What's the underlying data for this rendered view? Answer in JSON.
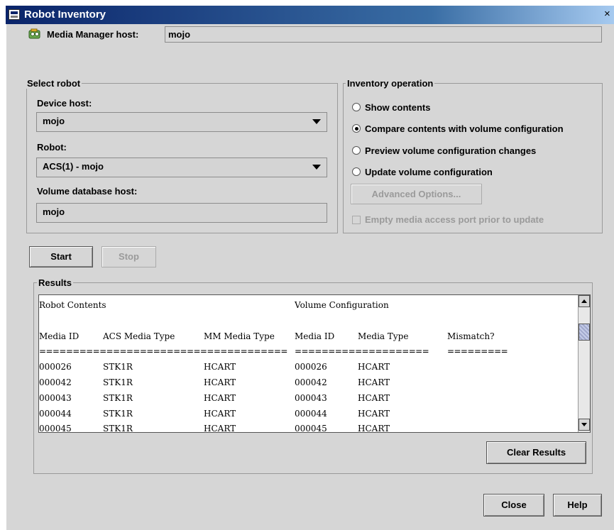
{
  "window": {
    "title": "Robot Inventory",
    "close_glyph": "×"
  },
  "media_manager": {
    "label": "Media Manager host:",
    "value": "mojo"
  },
  "select_robot": {
    "title": "Select robot",
    "device_host_label": "Device host:",
    "device_host_value": "mojo",
    "robot_label": "Robot:",
    "robot_value": "ACS(1) - mojo",
    "volume_db_label": "Volume database host:",
    "volume_db_value": "mojo"
  },
  "inventory": {
    "title": "Inventory operation",
    "options": [
      {
        "label": "Show contents",
        "checked": false
      },
      {
        "label": "Compare contents with volume configuration",
        "checked": true
      },
      {
        "label": "Preview volume configuration changes",
        "checked": false
      },
      {
        "label": "Update volume configuration",
        "checked": false
      }
    ],
    "advanced_label": "Advanced Options...",
    "empty_port_label": "Empty media access port prior to update"
  },
  "buttons": {
    "start": "Start",
    "stop": "Stop",
    "clear": "Clear Results",
    "close": "Close",
    "help": "Help"
  },
  "results": {
    "title": "Results",
    "header1_left": "Robot Contents",
    "header1_right": "Volume Configuration",
    "columns": [
      "Media ID",
      "ACS Media Type",
      "MM Media Type",
      "Media ID",
      "Media Type",
      "Mismatch?"
    ],
    "sep_left": "=====================================",
    "sep_mid": "====================",
    "sep_right": "=========",
    "rows": [
      [
        "000026",
        "STK1R",
        "HCART",
        "000026",
        "HCART",
        ""
      ],
      [
        "000042",
        "STK1R",
        "HCART",
        "000042",
        "HCART",
        ""
      ],
      [
        "000043",
        "STK1R",
        "HCART",
        "000043",
        "HCART",
        ""
      ],
      [
        "000044",
        "STK1R",
        "HCART",
        "000044",
        "HCART",
        ""
      ],
      [
        "000045",
        "STK1R",
        "HCART",
        "000045",
        "HCART",
        ""
      ]
    ]
  }
}
